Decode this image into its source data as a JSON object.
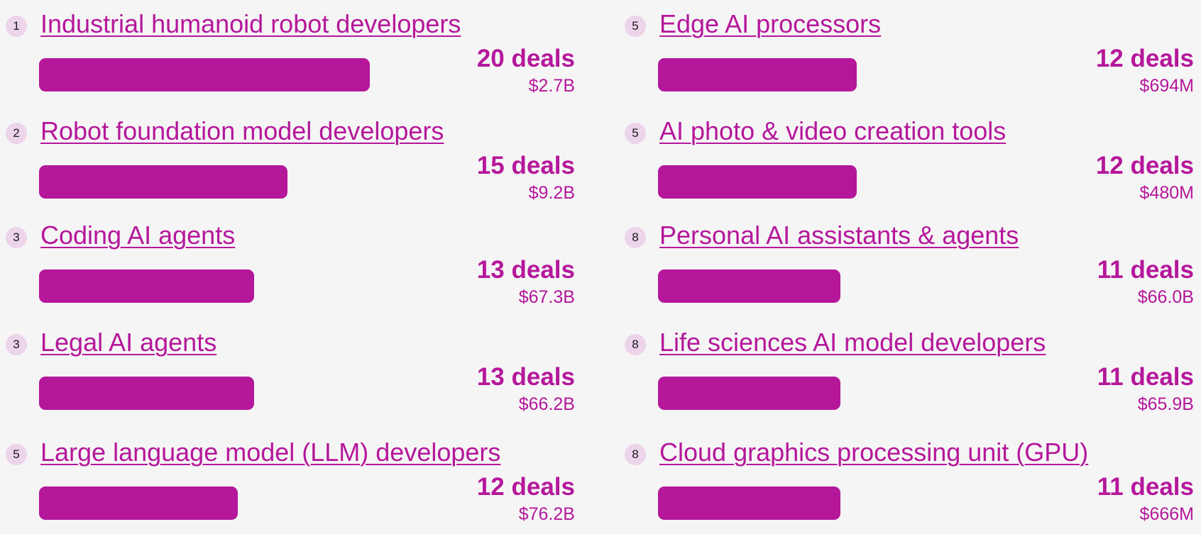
{
  "chart_data": {
    "type": "bar",
    "orientation": "horizontal",
    "max_deals": 20,
    "items": [
      {
        "rank": "1",
        "category": "Industrial humanoid robot developers",
        "deals": 20,
        "deals_label": "20 deals",
        "amount": "$2.7B"
      },
      {
        "rank": "2",
        "category": "Robot foundation model developers",
        "deals": 15,
        "deals_label": "15 deals",
        "amount": "$9.2B"
      },
      {
        "rank": "3",
        "category": "Coding AI agents",
        "deals": 13,
        "deals_label": "13 deals",
        "amount": "$67.3B"
      },
      {
        "rank": "3",
        "category": "Legal AI agents",
        "deals": 13,
        "deals_label": "13 deals",
        "amount": "$66.2B"
      },
      {
        "rank": "5",
        "category": "Large language model (LLM) developers",
        "deals": 12,
        "deals_label": "12 deals",
        "amount": "$76.2B"
      },
      {
        "rank": "5",
        "category": "Edge AI processors",
        "deals": 12,
        "deals_label": "12 deals",
        "amount": "$694M"
      },
      {
        "rank": "5",
        "category": "AI photo & video creation tools",
        "deals": 12,
        "deals_label": "12 deals",
        "amount": "$480M"
      },
      {
        "rank": "8",
        "category": "Personal AI assistants & agents",
        "deals": 11,
        "deals_label": "11 deals",
        "amount": "$66.0B"
      },
      {
        "rank": "8",
        "category": "Life sciences AI model developers",
        "deals": 11,
        "deals_label": "11 deals",
        "amount": "$65.9B"
      },
      {
        "rank": "8",
        "category": "Cloud graphics processing unit (GPU)",
        "deals": 11,
        "deals_label": "11 deals",
        "amount": "$666M"
      }
    ],
    "colors": {
      "bar": "#b5179b",
      "badge_bg": "#ecd4ea"
    }
  }
}
